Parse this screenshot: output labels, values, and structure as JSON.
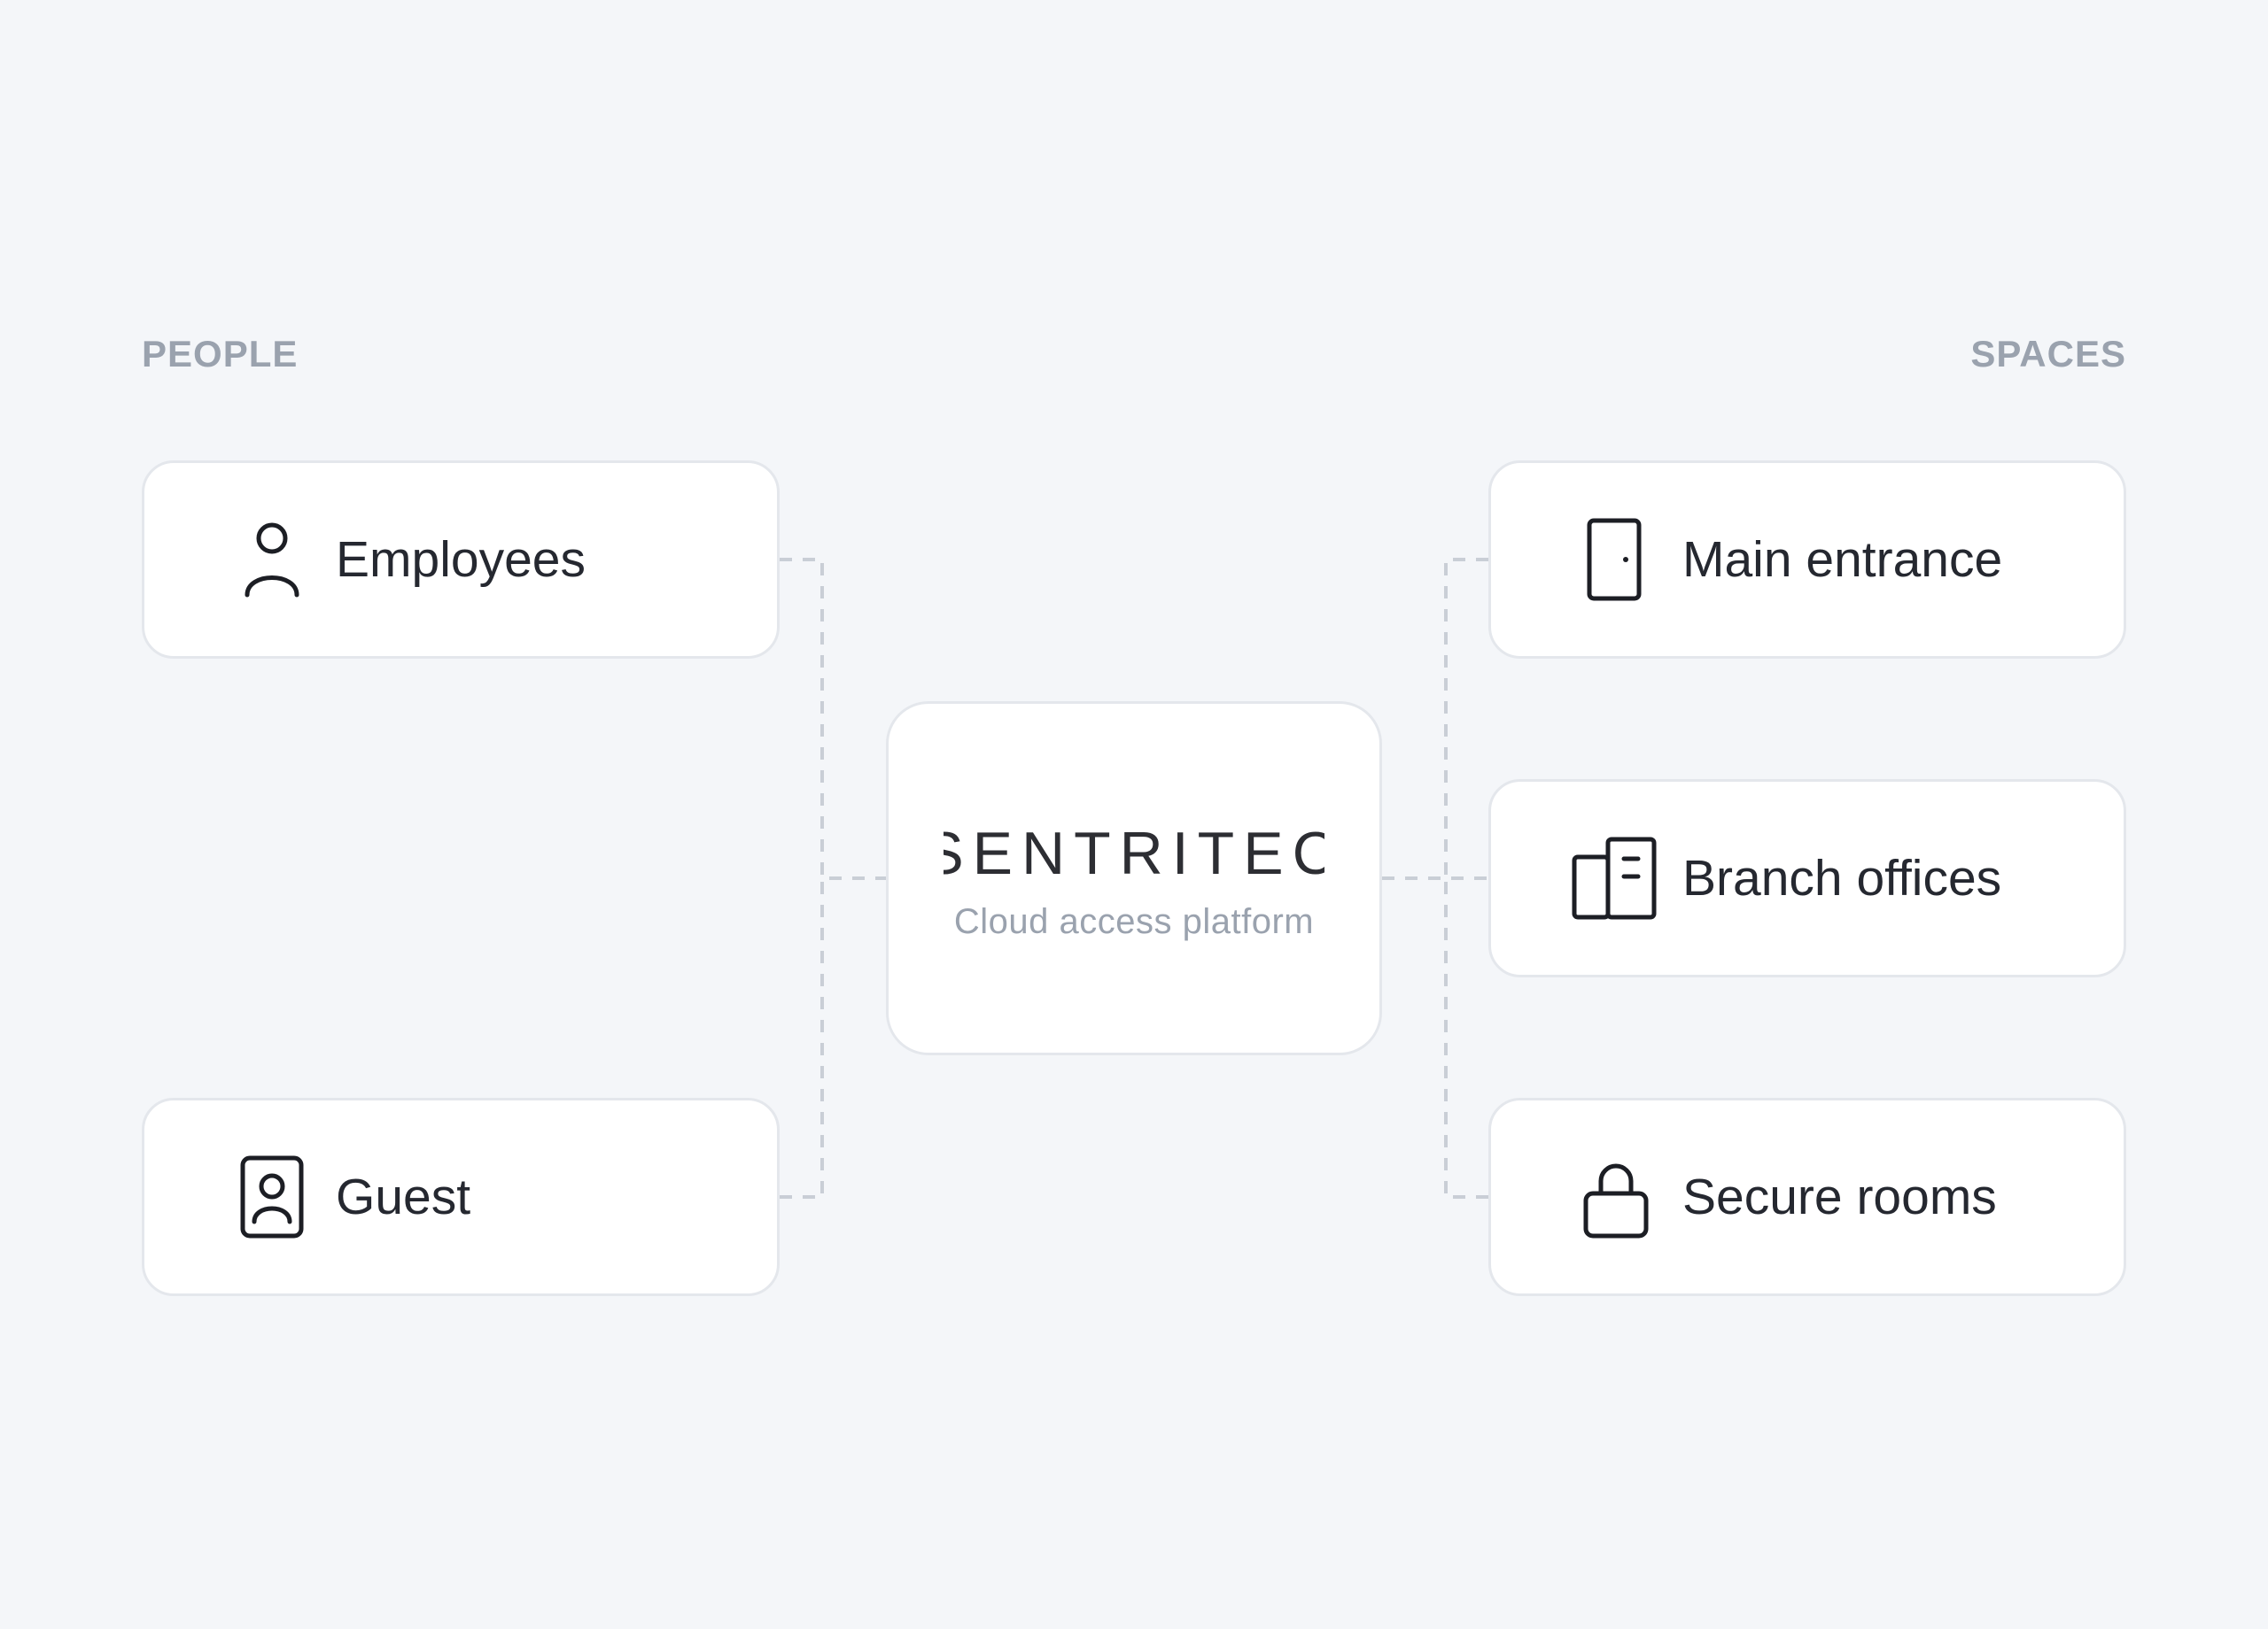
{
  "sections": {
    "people": "PEOPLE",
    "spaces": "SPACES"
  },
  "people": [
    {
      "label": "Employees",
      "icon": "person-icon"
    },
    {
      "label": "Guest",
      "icon": "id-badge-icon"
    }
  ],
  "hub": {
    "brand": "SENTRITEC",
    "tagline": "Cloud access platform"
  },
  "spaces": [
    {
      "label": "Main entrance",
      "icon": "door-icon"
    },
    {
      "label": "Branch offices",
      "icon": "buildings-icon"
    },
    {
      "label": "Secure rooms",
      "icon": "lock-icon"
    }
  ],
  "colors": {
    "background": "#f4f6f9",
    "card": "#ffffff",
    "card_border": "#e4e7ec",
    "connector": "#c9ced6",
    "muted_text": "#9aa2ae",
    "text": "#252830"
  }
}
